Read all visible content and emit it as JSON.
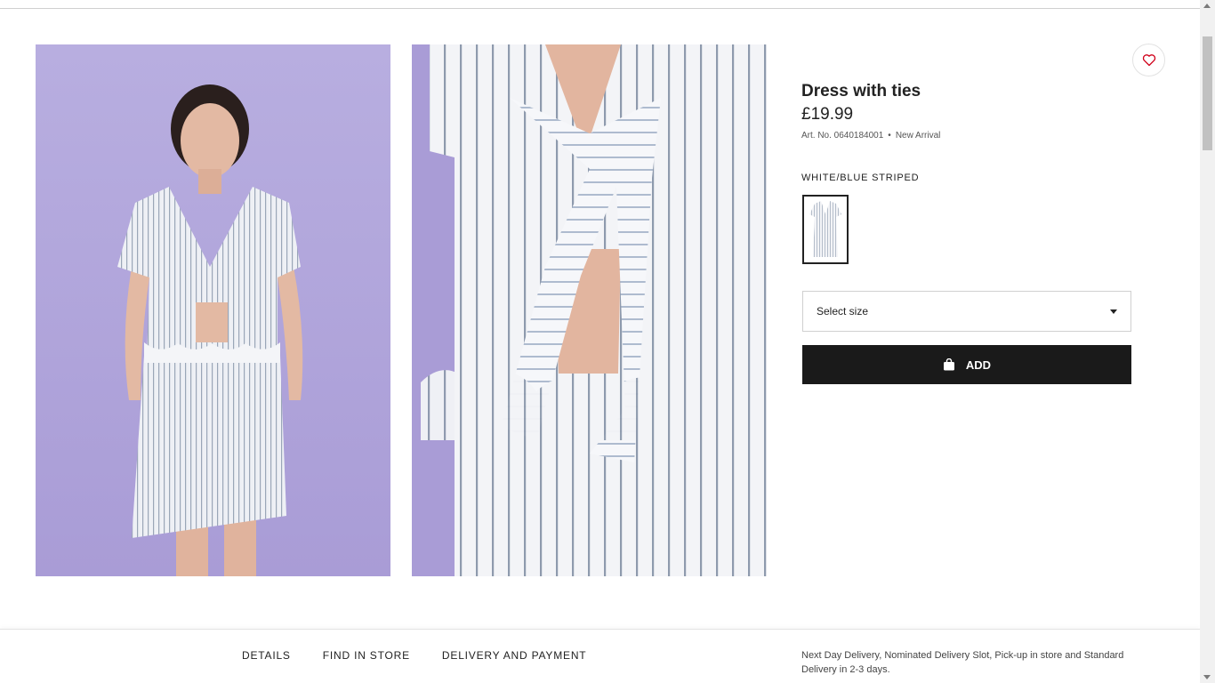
{
  "product": {
    "title": "Dress with ties",
    "price": "£19.99",
    "art_no": "Art. No. 0640184001",
    "separator": "•",
    "badge": "New Arrival",
    "color_name": "WHITE/BLUE STRIPED"
  },
  "size_select": {
    "label": "Select size"
  },
  "add_button": {
    "label": "ADD",
    "icon": "shopping-bag-icon"
  },
  "favourite": {
    "icon": "heart-icon",
    "color": "#d0021b"
  },
  "bottom_tabs": [
    {
      "label": "DETAILS"
    },
    {
      "label": "FIND IN STORE"
    },
    {
      "label": "DELIVERY AND PAYMENT"
    }
  ],
  "delivery_note": "Next Day Delivery, Nominated Delivery Slot, Pick-up in store and Standard Delivery in 2-3 days.",
  "colors": {
    "accent": "#1a1a1a",
    "photo_backdrop": "#b1a6dd",
    "heart": "#d0021b"
  }
}
